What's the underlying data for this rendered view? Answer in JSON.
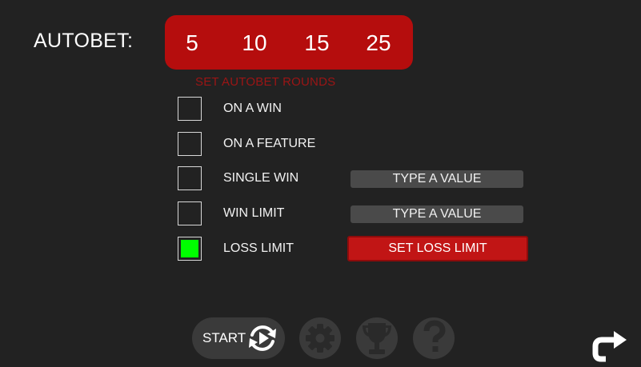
{
  "autobet": {
    "title": "AUTOBET:",
    "rounds": [
      "5",
      "10",
      "15",
      "25"
    ],
    "caption": "SET AUTOBET ROUNDS"
  },
  "options": [
    {
      "label": "ON A WIN",
      "checked": false
    },
    {
      "label": "ON A FEATURE",
      "checked": false
    },
    {
      "label": "SINGLE WIN",
      "checked": false,
      "button": "TYPE A VALUE"
    },
    {
      "label": "WIN LIMIT",
      "checked": false,
      "button": "TYPE A VALUE"
    },
    {
      "label": "LOSS LIMIT",
      "checked": true,
      "button": "SET LOSS LIMIT"
    }
  ],
  "toolbar": {
    "start_label": "START",
    "icons": [
      "autoplay-icon",
      "gear-icon",
      "trophy-icon",
      "question-icon",
      "back-arrow-icon"
    ]
  },
  "colors": {
    "background": "#222222",
    "accent_red": "#b50d0d",
    "caption_red": "#9b1515",
    "checked_green": "#00ff00",
    "field_gray": "#4a4a4a",
    "toolbar_gray": "#3a3a3a"
  }
}
